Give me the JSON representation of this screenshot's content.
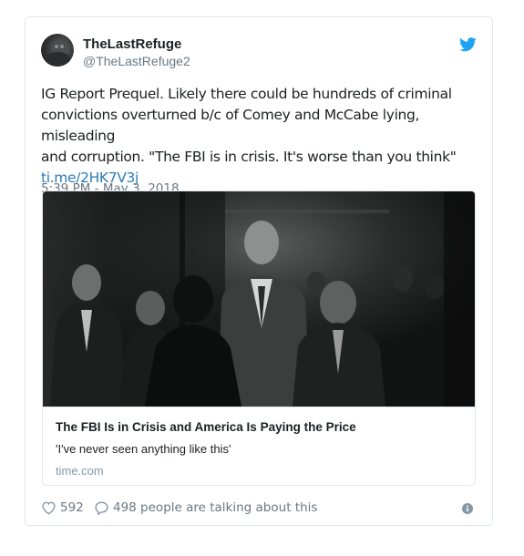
{
  "tweet": {
    "author": {
      "display_name": "TheLastRefuge",
      "handle": "@TheLastRefuge2"
    },
    "text_lines": [
      "IG Report Prequel.  Likely there could be hundreds of criminal",
      "convictions overturned b/c of Comey and McCabe lying, misleading",
      "and corruption. \"The FBI is in crisis. It's worse than you think\""
    ],
    "link": "ti.me/2HK7V3j",
    "timestamp": "5:39 PM - May 3, 2018"
  },
  "card": {
    "title": "The FBI Is in Crisis and America Is Paying the Price",
    "description": "'I've never seen anything like this'",
    "domain": "time.com"
  },
  "actions": {
    "like_count": "592",
    "reply_text": "498 people are talking about this"
  },
  "icons": {
    "brand": "twitter-bird-icon",
    "like": "heart-icon",
    "reply": "speech-bubble-icon",
    "info": "info-icon"
  },
  "colors": {
    "twitter_blue": "#1da1f2",
    "link": "#2b7bb9",
    "secondary_text": "#697882",
    "border": "#e1e8ed"
  }
}
